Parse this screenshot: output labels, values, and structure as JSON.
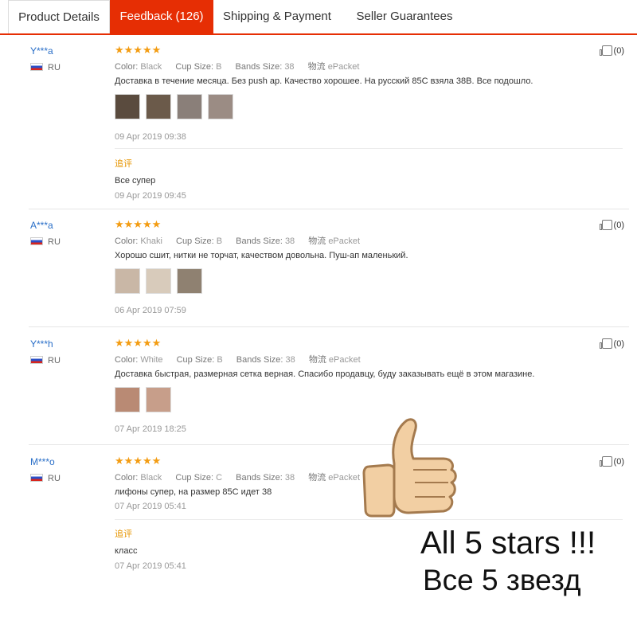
{
  "tabs": [
    "Product Details",
    "Feedback (126)",
    "Shipping & Payment",
    "Seller Guarantees"
  ],
  "labels": {
    "color": "Color:",
    "cup": "Cup Size:",
    "band": "Bands Size:",
    "logistics": "物流",
    "additional": "追评",
    "country": "RU",
    "stars": "★★★★★"
  },
  "reviews": [
    {
      "user": "Y***a",
      "color": "Black",
      "cup": "B",
      "band": "38",
      "shipping": "ePacket",
      "text": "Доставка в течение месяца. Без push ap. Качество хорошее. На русский 85С взяла 38В. Все подошло.",
      "date": "09 Apr 2019 09:38",
      "likes": "(0)",
      "additional": {
        "text": "Все супер",
        "date": "09 Apr 2019 09:45"
      }
    },
    {
      "user": "A***a",
      "color": "Khaki",
      "cup": "B",
      "band": "38",
      "shipping": "ePacket",
      "text": "Хорошо сшит, нитки не торчат, качеством довольна. Пуш-ап маленький.",
      "date": "06 Apr 2019 07:59",
      "likes": "(0)"
    },
    {
      "user": "Y***h",
      "color": "White",
      "cup": "B",
      "band": "38",
      "shipping": "ePacket",
      "text": "Доставка быстрая, размерная сетка верная. Спасибо продавцу, буду заказывать ещё в этом магазине.",
      "date": "07 Apr 2019 18:25",
      "likes": "(0)"
    },
    {
      "user": "M***o",
      "color": "Black",
      "cup": "C",
      "band": "38",
      "shipping": "ePacket",
      "text": "лифоны супер, на размер 85С идет 38",
      "date": "07 Apr 2019 05:41",
      "likes": "(0)",
      "additional": {
        "text": "класс",
        "date": "07 Apr 2019 05:41"
      }
    }
  ],
  "promo": {
    "line1": "All 5 stars !!!",
    "line2": "Все 5 звезд"
  },
  "colors": {
    "accent": "#e62e04",
    "star": "#f39c12",
    "link": "#2a6fc8",
    "additional": "#e69500"
  }
}
